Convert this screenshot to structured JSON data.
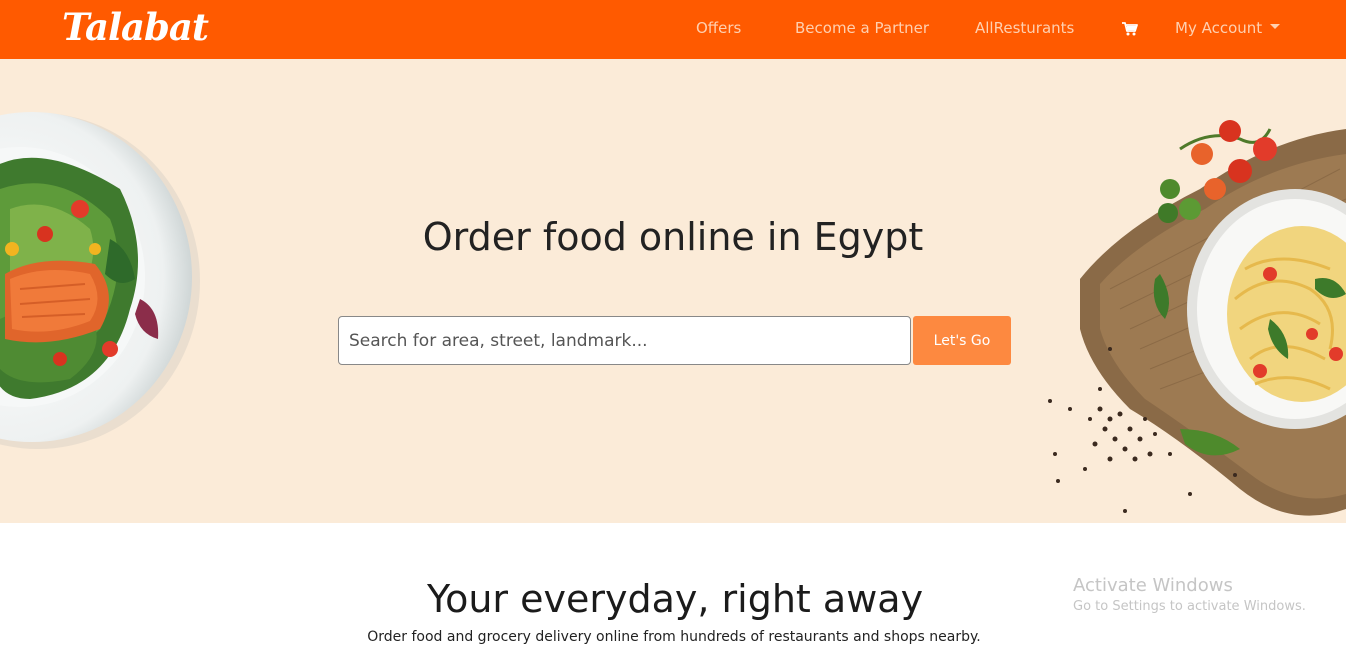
{
  "navbar": {
    "brand": "Talabat",
    "links": {
      "offers": "Offers",
      "partner": "Become a Partner",
      "all_restaurants": "AllResturants",
      "account": "My Account"
    },
    "background": "#ff5a00"
  },
  "hero": {
    "title": "Order food online in Egypt",
    "search_placeholder": "Search for area, street, landmark...",
    "go_button": "Let's Go",
    "background": "#fbebd8",
    "button_color": "#fd8940"
  },
  "section2": {
    "title": "Your everyday, right away",
    "subtitle": "Order food and grocery delivery online from hundreds of restaurants and shops nearby."
  },
  "watermark": {
    "title": "Activate Windows",
    "subtitle": "Go to Settings to activate Windows."
  }
}
